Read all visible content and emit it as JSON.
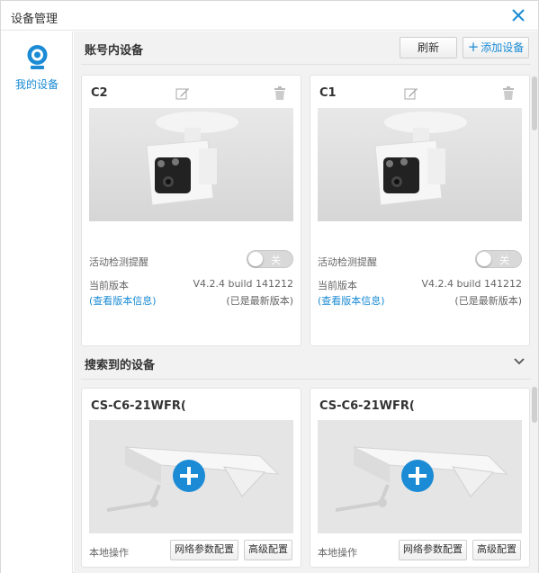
{
  "window": {
    "title": "设备管理"
  },
  "sidebar": {
    "items": [
      {
        "label": "我的设备",
        "icon": "camera-icon",
        "active": true
      }
    ]
  },
  "account_devices": {
    "section_title": "账号内设备",
    "refresh_label": "刷新",
    "add_label": "添加设备",
    "cards": [
      {
        "name": "C2",
        "motion_label": "活动检测提醒",
        "toggle_label": "关",
        "version_label": "当前版本",
        "version_value": "V4.2.4 build 141212",
        "view_info_link": "查看版本信息",
        "latest_text": "(已是最新版本)"
      },
      {
        "name": "C1",
        "motion_label": "活动检测提醒",
        "toggle_label": "关",
        "version_label": "当前版本",
        "version_value": "V4.2.4 build 141212",
        "view_info_link": "查看版本信息",
        "latest_text": "(已是最新版本)"
      }
    ]
  },
  "found_devices": {
    "section_title": "搜索到的设备",
    "cards": [
      {
        "name": "CS-C6-21WFR(",
        "local_label": "本地操作",
        "net_config_label": "网络参数配置",
        "adv_config_label": "高级配置"
      },
      {
        "name": "CS-C6-21WFR(",
        "local_label": "本地操作",
        "net_config_label": "网络参数配置",
        "adv_config_label": "高级配置"
      }
    ]
  },
  "colors": {
    "accent": "#1a8bd4",
    "panel_bg": "#f2f2f2"
  }
}
